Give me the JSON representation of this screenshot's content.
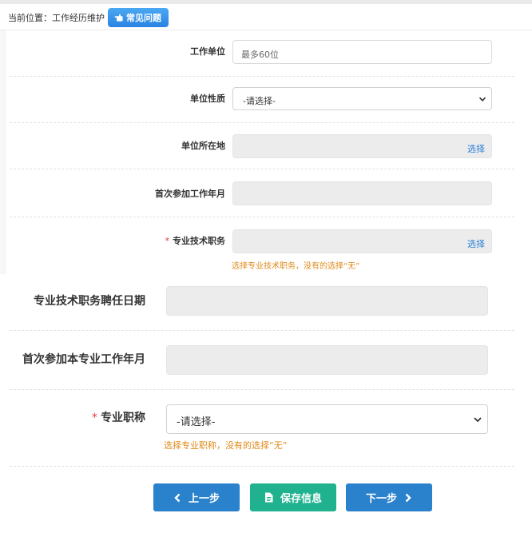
{
  "breadcrumb": {
    "label": "当前位置：工作经历维护"
  },
  "faq_button": {
    "label": "常见问题",
    "icon": "hand-pointer-icon"
  },
  "form": {
    "employer": {
      "label": "工作单位",
      "placeholder": "最多60位"
    },
    "unit_type": {
      "label": "单位性质",
      "value": "-请选择-"
    },
    "unit_location": {
      "label": "单位所在地",
      "action": "选择"
    },
    "first_work_date": {
      "label": "首次参加工作年月"
    },
    "tech_position": {
      "label": "专业技术职务",
      "required": "*",
      "action": "选择",
      "hint": "选择专业技术职务，没有的选择“无”"
    },
    "tech_appoint_date": {
      "label": "专业技术职务聘任日期"
    },
    "first_prof_work_date": {
      "label": "首次参加本专业工作年月"
    },
    "prof_title": {
      "label": "专业职称",
      "required": "*",
      "value": "-请选择-",
      "hint": "选择专业职称，没有的选择“无”"
    }
  },
  "buttons": {
    "prev": "上一步",
    "save": "保存信息",
    "next": "下一步"
  },
  "colors": {
    "primary": "#2a81cc",
    "save": "#20b28f",
    "hint": "#e08a1a",
    "required": "#e63b3b",
    "link": "#2a7fd8"
  }
}
